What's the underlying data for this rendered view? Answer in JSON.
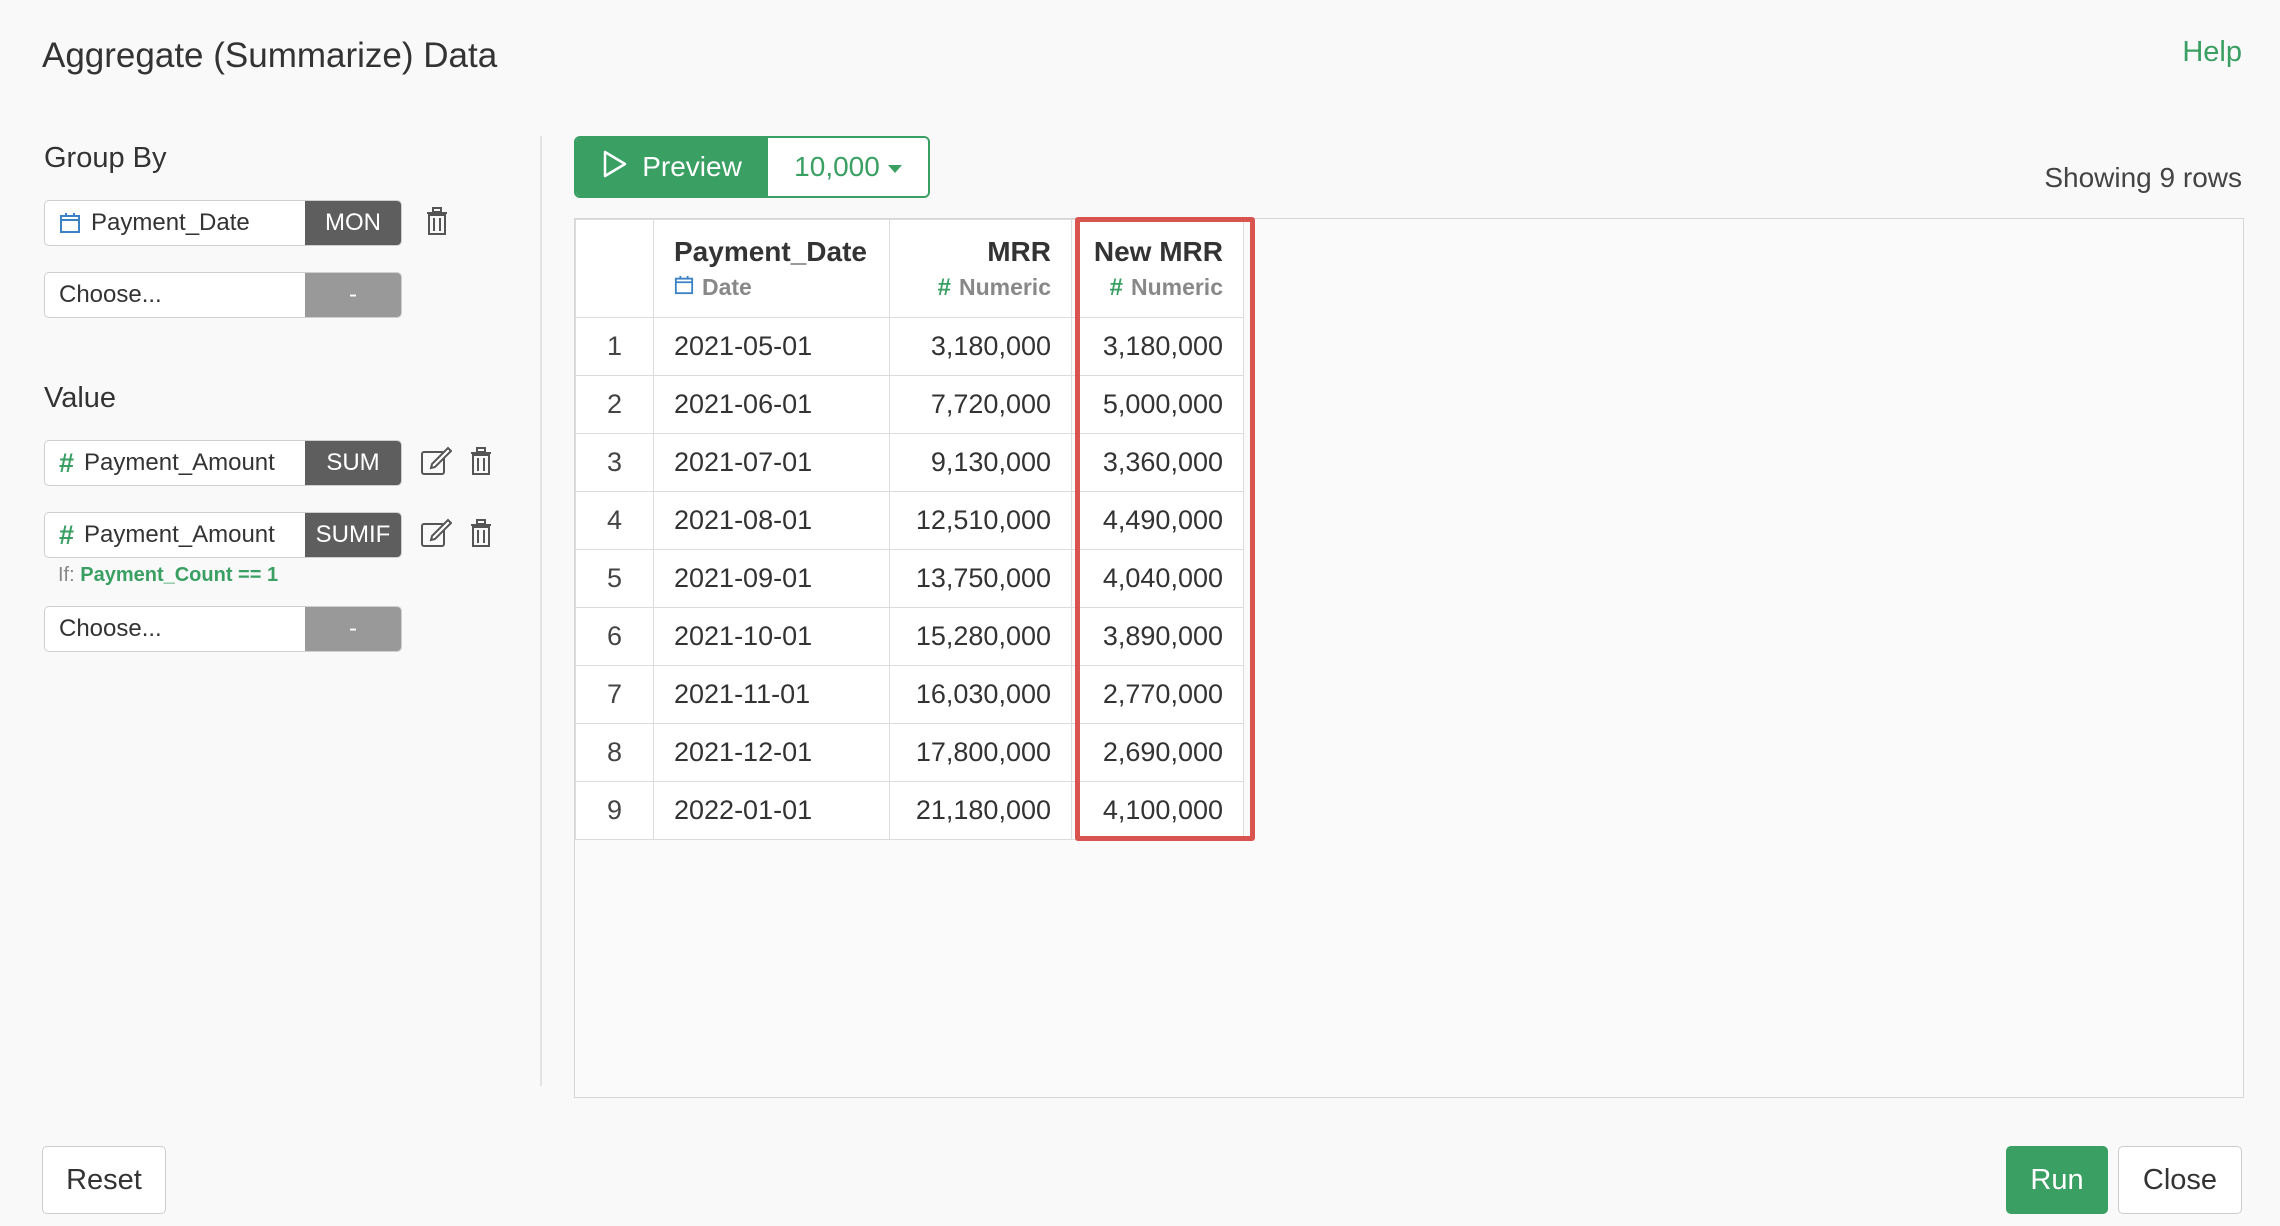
{
  "dialog": {
    "title": "Aggregate (Summarize) Data",
    "help_label": "Help"
  },
  "group_by": {
    "label": "Group By",
    "items": [
      {
        "field": "Payment_Date",
        "icon": "calendar-icon",
        "function": "MON"
      }
    ],
    "choose_placeholder": "Choose...",
    "choose_tag": "-"
  },
  "value": {
    "label": "Value",
    "items": [
      {
        "field": "Payment_Amount",
        "icon": "hash-icon",
        "function": "SUM"
      },
      {
        "field": "Payment_Amount",
        "icon": "hash-icon",
        "function": "SUMIF",
        "condition_prefix": "If:",
        "condition": "Payment_Count == 1"
      }
    ],
    "choose_placeholder": "Choose...",
    "choose_tag": "-"
  },
  "preview": {
    "label": "Preview",
    "count": "10,000",
    "showing": "Showing 9 rows"
  },
  "table": {
    "columns": [
      {
        "name": "Payment_Date",
        "type": "Date",
        "icon": "calendar-icon"
      },
      {
        "name": "MRR",
        "type": "Numeric",
        "icon": "hash-icon"
      },
      {
        "name": "New MRR",
        "type": "Numeric",
        "icon": "hash-icon",
        "highlighted": true
      }
    ],
    "rows": [
      [
        "1",
        "2021-05-01",
        "3,180,000",
        "3,180,000"
      ],
      [
        "2",
        "2021-06-01",
        "7,720,000",
        "5,000,000"
      ],
      [
        "3",
        "2021-07-01",
        "9,130,000",
        "3,360,000"
      ],
      [
        "4",
        "2021-08-01",
        "12,510,000",
        "4,490,000"
      ],
      [
        "5",
        "2021-09-01",
        "13,750,000",
        "4,040,000"
      ],
      [
        "6",
        "2021-10-01",
        "15,280,000",
        "3,890,000"
      ],
      [
        "7",
        "2021-11-01",
        "16,030,000",
        "2,770,000"
      ],
      [
        "8",
        "2021-12-01",
        "17,800,000",
        "2,690,000"
      ],
      [
        "9",
        "2022-01-01",
        "21,180,000",
        "4,100,000"
      ]
    ]
  },
  "footer": {
    "reset_label": "Reset",
    "run_label": "Run",
    "close_label": "Close"
  },
  "colors": {
    "accent": "#3a9f63",
    "highlight": "#d9534f",
    "tag": "#5e5e5e",
    "date_icon": "#3b82c4"
  }
}
